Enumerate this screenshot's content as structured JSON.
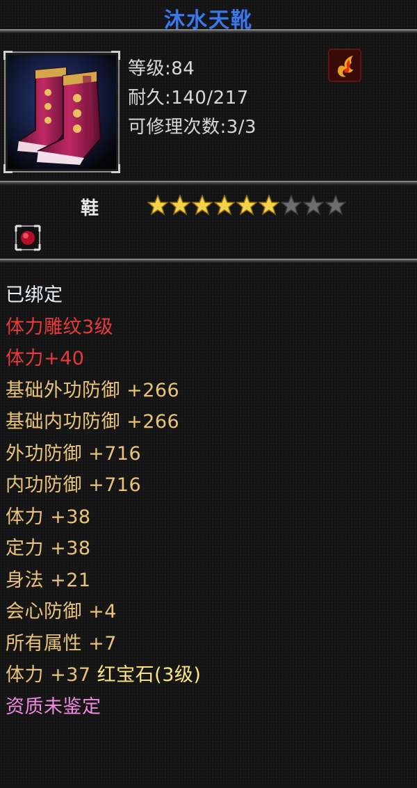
{
  "item": {
    "name": "沐水天靴",
    "level": "等级:84",
    "durability": "耐久:140/217",
    "repairs": "可修理次数:3/3",
    "type": "鞋",
    "icon": "boots-icon",
    "school_icon": "flame-emblem-icon",
    "gem_slot_icon": "red-gem-icon"
  },
  "rating": {
    "filled": 6,
    "total": 9
  },
  "attributes": [
    {
      "text": "已绑定",
      "color": "#e6f0f6"
    },
    {
      "text": "体力雕纹3级",
      "color": "#e83a3a"
    },
    {
      "text": "体力+40",
      "color": "#e83a3a"
    },
    {
      "text": "基础外功防御 +266",
      "color": "#e9c47a"
    },
    {
      "text": "基础内功防御 +266",
      "color": "#e9c47a"
    },
    {
      "text": "外功防御 +716",
      "color": "#e9c47a"
    },
    {
      "text": "内功防御 +716",
      "color": "#e9c47a"
    },
    {
      "text": "体力 +38",
      "color": "#e9c47a"
    },
    {
      "text": "定力 +38",
      "color": "#e9c47a"
    },
    {
      "text": "身法 +21",
      "color": "#e9c47a"
    },
    {
      "text": "会心防御 +4",
      "color": "#e9c47a"
    },
    {
      "text": "所有属性 +7",
      "color": "#e9c47a"
    },
    {
      "text": "体力 +37 ",
      "color": "#e9c47a",
      "gem": "红宝石(3级)"
    },
    {
      "text": "资质未鉴定",
      "color": "#f08ae0"
    }
  ],
  "colors": {
    "title": "#3f78e0",
    "star_filled": "#f2d44a",
    "star_empty": "#6e6e6e"
  }
}
